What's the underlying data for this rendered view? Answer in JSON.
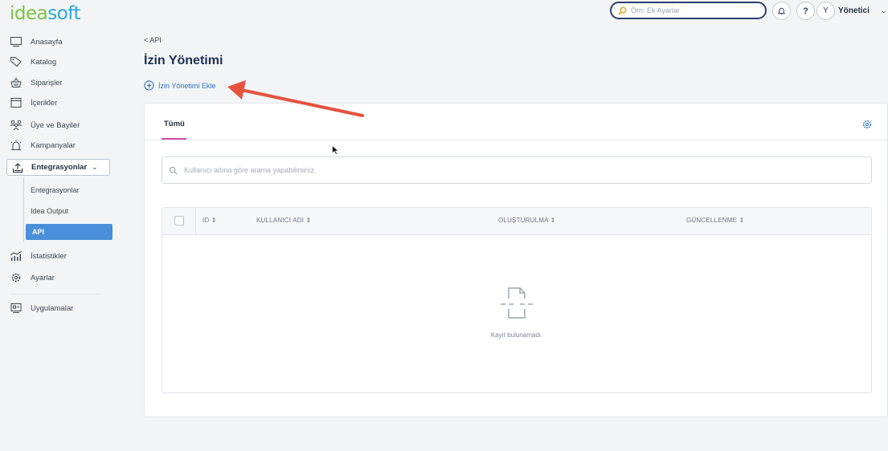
{
  "header": {
    "logo_part1": "idea",
    "logo_part2": "soft",
    "search_placeholder": "Örn: Ek Ayarlar",
    "help_label": "?",
    "avatar_initial": "Y",
    "user_name": "Yönetici",
    "user_chevron": "⌄"
  },
  "sidebar": {
    "items": [
      {
        "label": "Anasayfa",
        "icon": "monitor-icon"
      },
      {
        "label": "Katalog",
        "icon": "tag-icon"
      },
      {
        "label": "Siparişler",
        "icon": "basket-icon"
      },
      {
        "label": "İçerikler",
        "icon": "document-icon"
      },
      {
        "label": "Üye ve Bayiler",
        "icon": "users-icon"
      },
      {
        "label": "Kampanyalar",
        "icon": "siren-icon"
      }
    ],
    "active_group": {
      "label": "Entegrasyonlar",
      "chevron": "⌄",
      "icon": "upload-icon"
    },
    "sub_items": [
      "Entegrasyonlar",
      "Idea Output",
      "API"
    ],
    "bottom_items": [
      {
        "label": "İstatistikler",
        "icon": "chart-icon"
      },
      {
        "label": "Ayarlar",
        "icon": "gear-icon"
      }
    ],
    "apps": {
      "label": "Uygulamalar",
      "icon": "apps-icon"
    }
  },
  "main": {
    "back_label": "< API",
    "title": "İzin Yönetimi",
    "add_label": "İzin Yönetimi Ekle",
    "tab_label": "Tümü",
    "search_placeholder": "Kullanıcı adına göre arama yapabilirsiniz.",
    "columns": [
      "ID ⇕",
      "KULLANICI ADI ⇕",
      "OLUŞTURULMA ⇕",
      "GÜNCELLENME ⇕"
    ],
    "empty_text": "Kayıt bulunamadı."
  },
  "colors": {
    "accent": "#2a6fb8",
    "active_nav": "#4a8fd9",
    "tab_underline": "#d04ab0",
    "annotation_arrow": "#e5533f"
  }
}
